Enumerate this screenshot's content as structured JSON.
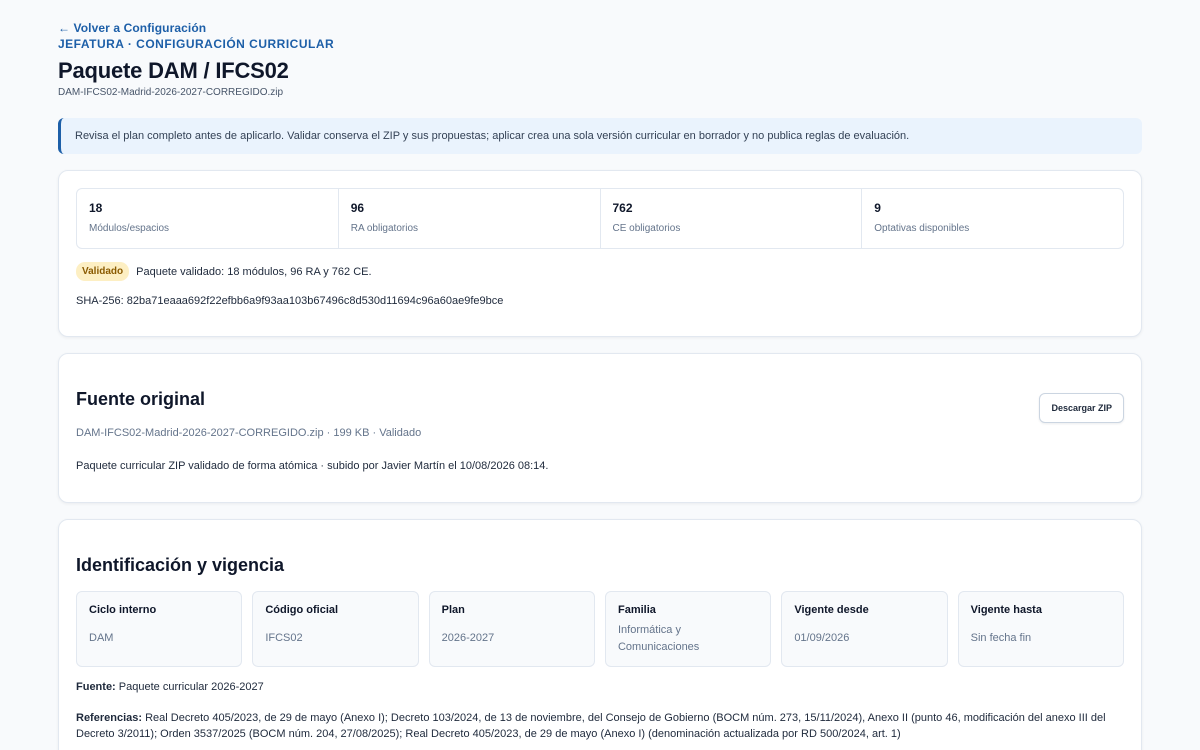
{
  "header": {
    "back_link": "← Volver a Configuración",
    "eyebrow": "JEFATURA · CONFIGURACIÓN CURRICULAR",
    "title": "Paquete DAM / IFCS02",
    "subtitle": "DAM-IFCS02-Madrid-2026-2027-CORREGIDO.zip"
  },
  "notice": {
    "text": "Revisa el plan completo antes de aplicarlo. Validar conserva el ZIP y sus propuestas; aplicar crea una sola versión curricular en borrador y no publica reglas de evaluación."
  },
  "stats": [
    {
      "value": "18",
      "label": "Módulos/espacios"
    },
    {
      "value": "96",
      "label": "RA obligatorios"
    },
    {
      "value": "762",
      "label": "CE obligatorios"
    },
    {
      "value": "9",
      "label": "Optativas disponibles"
    }
  ],
  "validation": {
    "badge": "Validado",
    "badge_color": "#fdefc3",
    "message": "Paquete validado: 18 módulos, 96 RA y 762 CE.",
    "sha": "SHA-256: 82ba71eaaa692f22efbb6a9f93aa103b67496c8d530d11694c96a60ae9fe9bce"
  },
  "source": {
    "title": "Fuente original",
    "file_meta": "DAM-IFCS02-Madrid-2026-2027-CORREGIDO.zip · 199 KB · Validado",
    "description": "Paquete curricular ZIP validado de forma atómica · subido por Javier Martín el 10/08/2026 08:14.",
    "download_button": "Descargar ZIP"
  },
  "identification": {
    "title": "Identificación y vigencia",
    "fields": [
      {
        "label": "Ciclo interno",
        "value": "DAM"
      },
      {
        "label": "Código oficial",
        "value": "IFCS02"
      },
      {
        "label": "Plan",
        "value": "2026-2027"
      },
      {
        "label": "Familia",
        "value": "Informática y Comunicaciones"
      },
      {
        "label": "Vigente desde",
        "value": "01/09/2026"
      },
      {
        "label": "Vigente hasta",
        "value": "Sin fecha fin"
      }
    ],
    "fuente_label": "Fuente:",
    "fuente_value": "Paquete curricular 2026-2027",
    "refs_label": "Referencias:",
    "refs_value": "Real Decreto 405/2023, de 29 de mayo (Anexo I); Decreto 103/2024, de 13 de noviembre, del Consejo de Gobierno (BOCM núm. 273, 15/11/2024), Anexo II (punto 46, modificación del anexo III del Decreto 3/2011); Orden 3537/2025 (BOCM núm. 204, 27/08/2025); Real Decreto 405/2023, de 29 de mayo (Anexo I) (denominación actualizada por RD 500/2024, art. 1)"
  },
  "colors": {
    "accent": "#1d5fa8",
    "notice_bg": "#eaf3fd",
    "page_bg": "#f8fafc"
  }
}
